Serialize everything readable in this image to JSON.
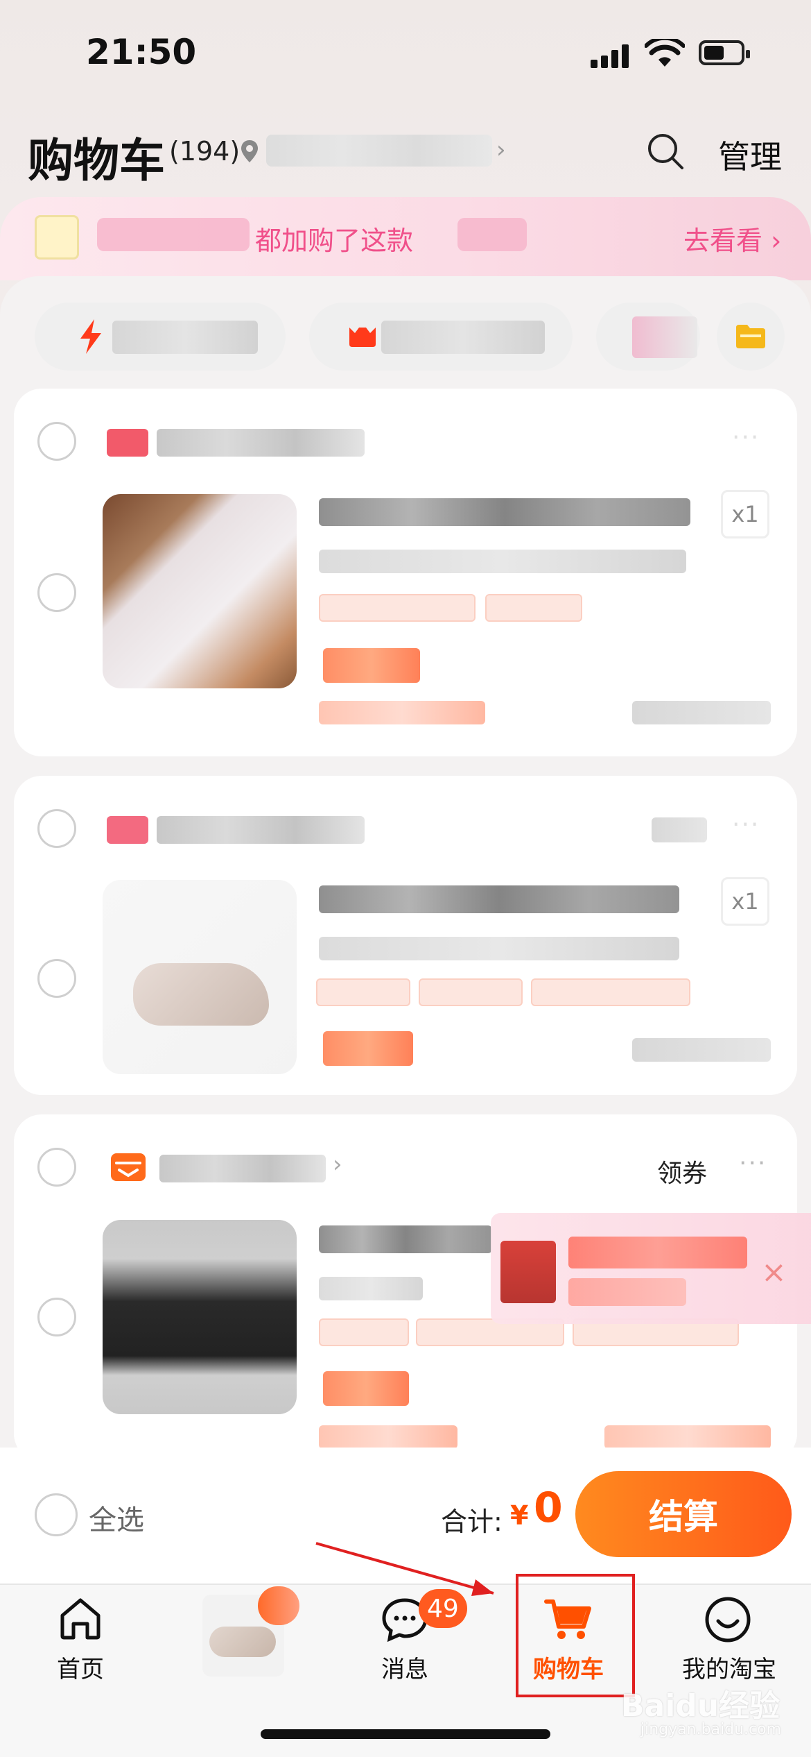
{
  "status_bar": {
    "time": "21:50"
  },
  "header": {
    "title": "购物车",
    "count": "(194)",
    "manage": "管理"
  },
  "banner": {
    "text": "都加购了这款",
    "action": "去看看 ›"
  },
  "cards": [
    {
      "qty": "x1"
    },
    {
      "qty": "x1"
    },
    {
      "coupon": "领券"
    }
  ],
  "checkout": {
    "select_all": "全选",
    "total_label": "合计:",
    "currency": "¥",
    "total_value": "0",
    "button": "结算"
  },
  "tabbar": {
    "items": [
      {
        "label": "首页"
      },
      {
        "label": ""
      },
      {
        "label": "消息",
        "badge": "49"
      },
      {
        "label": "购物车"
      },
      {
        "label": "我的淘宝"
      }
    ]
  },
  "colors": {
    "accent": "#ff5000",
    "cart_active": "#ff5000",
    "banner_text": "#f0508a"
  },
  "watermark": {
    "brand": "Baidu经验",
    "url": "jingyan.baidu.com"
  }
}
